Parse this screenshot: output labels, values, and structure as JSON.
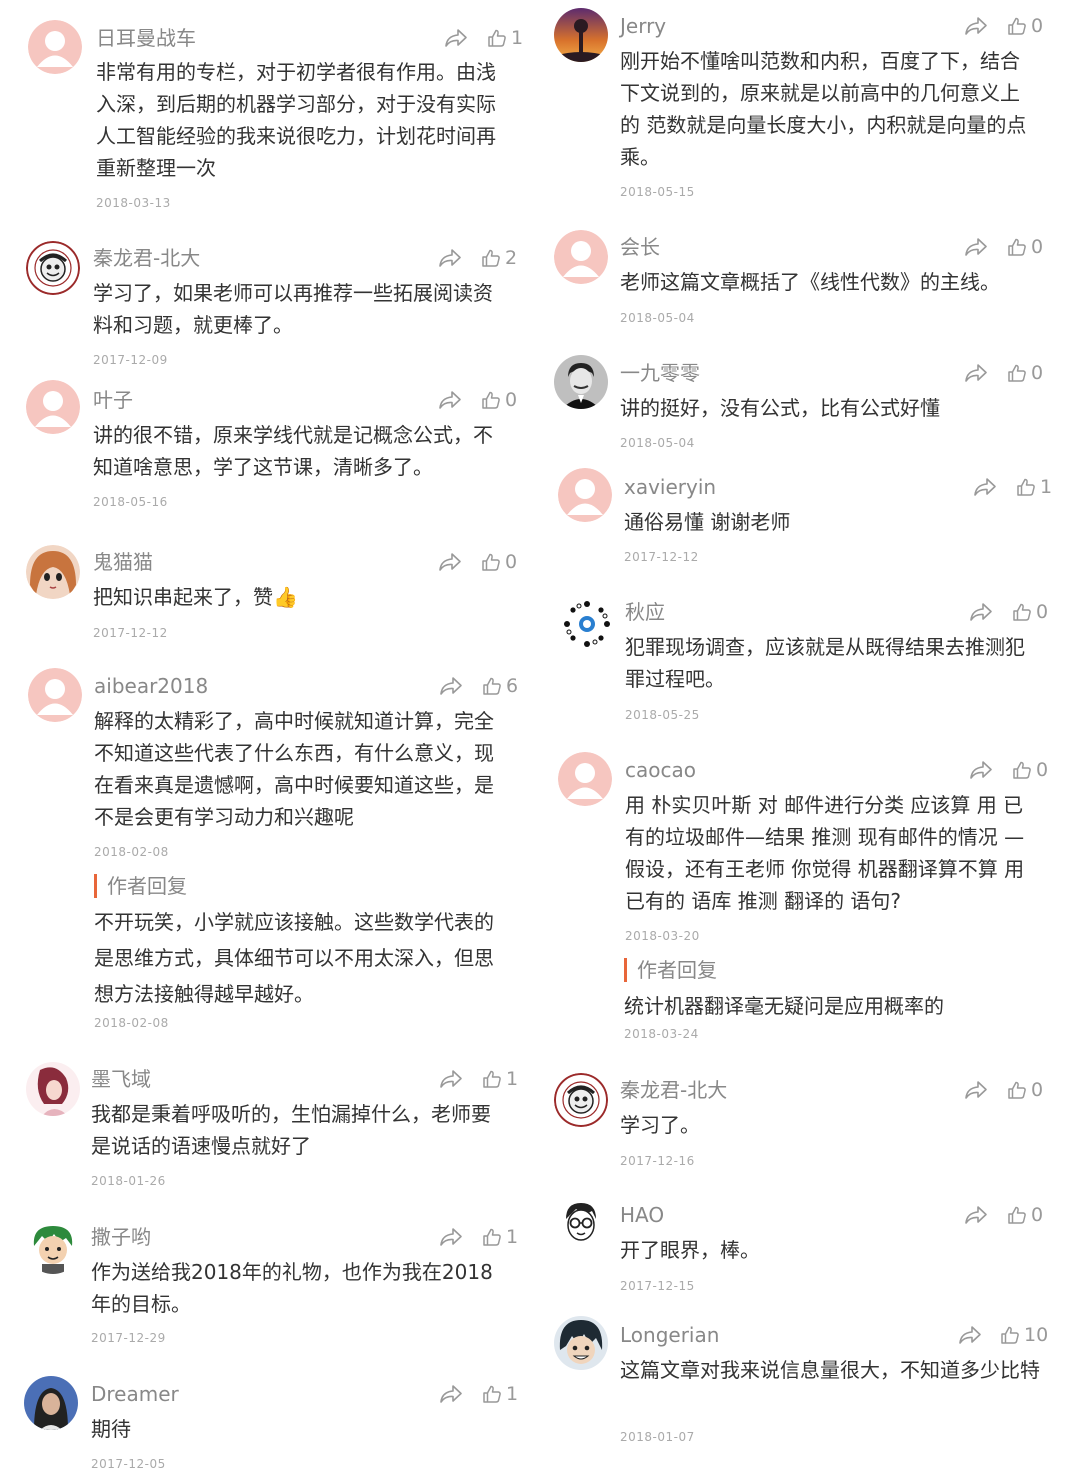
{
  "reply_label": "作者回复",
  "left_comments": [
    {
      "name": "日耳曼战车",
      "likes": "1",
      "avatar": "default-avatar-icon",
      "text": "非常有用的专栏，对于初学者很有作用。由浅入深，到后期的机器学习部分，对于没有实际人工智能经验的我来说很吃力，计划花时间再重新整理一次",
      "date": "2018-03-13"
    },
    {
      "name": "秦龙君-北大",
      "likes": "2",
      "avatar": "peking-university-seal-avatar",
      "text": "学习了，如果老师可以再推荐一些拓展阅读资料和习题，就更棒了。",
      "date": "2017-12-09"
    },
    {
      "name": "叶子",
      "likes": "0",
      "avatar": "default-avatar-icon",
      "text": "讲的很不错，原来学线代就是记概念公式，不知道啥意思，学了这节课，清晰多了。",
      "date": "2018-05-16"
    },
    {
      "name": "鬼猫猫",
      "likes": "0",
      "avatar": "anime-girl-avatar",
      "text": "把知识串起来了，赞👍",
      "date": "2017-12-12"
    },
    {
      "name": "aibear2018",
      "likes": "6",
      "avatar": "default-avatar-icon",
      "text": "解释的太精彩了，高中时候就知道计算，完全不知道这些代表了什么东西，有什么意义，现在看来真是遗憾啊，高中时候要知道这些，是不是会更有学习动力和兴趣呢",
      "date": "2018-02-08",
      "reply": {
        "text": "不开玩笑，小学就应该接触。这些数学代表的是思维方式，具体细节可以不用太深入，但思想方法接触得越早越好。",
        "date": "2018-02-08"
      }
    },
    {
      "name": "墨飞域",
      "likes": "1",
      "avatar": "illustration-girl-avatar",
      "text": "我都是秉着呼吸听的，生怕漏掉什么，老师要是说话的语速慢点就好了",
      "date": "2018-01-26"
    },
    {
      "name": "撒子哟",
      "likes": "1",
      "avatar": "green-hair-cartoon-avatar",
      "text": "作为送给我2018年的礼物，也作为我在2018年的目标。",
      "date": "2017-12-29"
    },
    {
      "name": "Dreamer",
      "likes": "1",
      "avatar": "girl-photo-avatar",
      "text": "期待",
      "date": "2017-12-05"
    }
  ],
  "right_comments": [
    {
      "name": "Jerry",
      "likes": "0",
      "avatar": "sunset-silhouette-avatar",
      "text": "刚开始不懂啥叫范数和内积，百度了下，结合下文说到的，原来就是以前高中的几何意义上的 范数就是向量长度大小，内积就是向量的点乘。",
      "date": "2018-05-15"
    },
    {
      "name": "会长",
      "likes": "0",
      "avatar": "default-avatar-icon",
      "text": "老师这篇文章概括了《线性代数》的主线。",
      "date": "2018-05-04"
    },
    {
      "name": "一九零零",
      "likes": "0",
      "avatar": "vintage-portrait-avatar",
      "text": "讲的挺好，没有公式，比有公式好懂",
      "date": "2018-05-04"
    },
    {
      "name": "xavieryin",
      "likes": "1",
      "avatar": "default-avatar-icon",
      "text": "通俗易懂 谢谢老师",
      "date": "2017-12-12"
    },
    {
      "name": "秋应",
      "likes": "0",
      "avatar": "dots-ring-logo-avatar",
      "text": "犯罪现场调查，应该就是从既得结果去推测犯罪过程吧。",
      "date": "2018-05-25"
    },
    {
      "name": "caocao",
      "likes": "0",
      "avatar": "default-avatar-icon",
      "text": "用 朴实贝叶斯 对 邮件进行分类 应该算 用 已有的垃圾邮件—结果 推测 现有邮件的情况 —假设，还有王老师 你觉得 机器翻译算不算 用 已有的 语库 推测 翻译的 语句?",
      "date": "2018-03-20",
      "reply": {
        "text": "统计机器翻译毫无疑问是应用概率的",
        "date": "2018-03-24"
      }
    },
    {
      "name": "秦龙君-北大",
      "likes": "0",
      "avatar": "peking-university-seal-avatar",
      "text": "学习了。",
      "date": "2017-12-16"
    },
    {
      "name": "HAO",
      "likes": "0",
      "avatar": "glasses-cartoon-avatar",
      "text": "开了眼界，棒。",
      "date": "2017-12-15"
    },
    {
      "name": "Longerian",
      "likes": "10",
      "avatar": "dark-hair-cartoon-avatar",
      "text": "这篇文章对我来说信息量很大，不知道多少比特",
      "date": "2018-01-07"
    }
  ]
}
